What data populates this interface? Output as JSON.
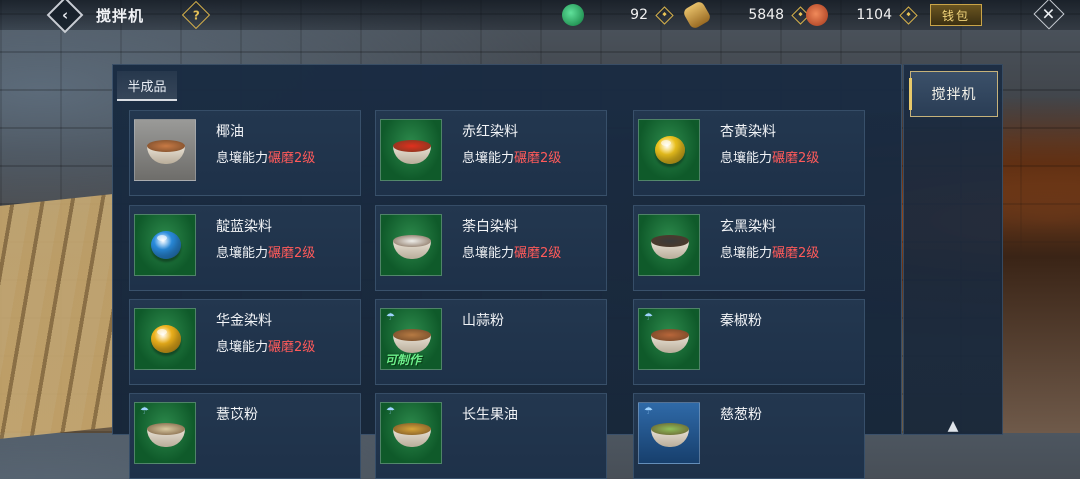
{
  "header": {
    "title": "搅拌机",
    "help_glyph": "?",
    "currencies": [
      {
        "name": "jade",
        "icon": "jade-coin-icon",
        "value": "92",
        "color": "#1fa45c"
      },
      {
        "name": "gold",
        "icon": "gold-ingot-icon",
        "value": "5848",
        "color": "#c99a3b"
      },
      {
        "name": "copper",
        "icon": "copper-coin-icon",
        "value": "1104",
        "color": "#d2633a"
      }
    ],
    "bag_label": "钱包",
    "close_glyph": "✕",
    "back_glyph": "‹"
  },
  "panel": {
    "tab_label": "半成品",
    "items": [
      {
        "name": "椰油",
        "req_prefix": "息壤能力",
        "req_level": "碾磨2级",
        "icon": "coconut-oil-icon",
        "bg": "grey",
        "fill": "#c87a45",
        "type": "bowl"
      },
      {
        "name": "赤红染料",
        "req_prefix": "息壤能力",
        "req_level": "碾磨2级",
        "icon": "red-dye-icon",
        "bg": "green",
        "fill": "#e0301e",
        "type": "bowl"
      },
      {
        "name": "杏黄染料",
        "req_prefix": "息壤能力",
        "req_level": "碾磨2级",
        "icon": "yellow-dye-icon",
        "bg": "green",
        "fill": "#f0c51e",
        "type": "orb"
      },
      {
        "name": "靛蓝染料",
        "req_prefix": "息壤能力",
        "req_level": "碾磨2级",
        "icon": "blue-dye-icon",
        "bg": "green",
        "fill": "#2a8ee0",
        "type": "orb"
      },
      {
        "name": "荼白染料",
        "req_prefix": "息壤能力",
        "req_level": "碾磨2级",
        "icon": "white-dye-icon",
        "bg": "green",
        "fill": "#eeeeea",
        "type": "bowl"
      },
      {
        "name": "玄黑染料",
        "req_prefix": "息壤能力",
        "req_level": "碾磨2级",
        "icon": "black-dye-icon",
        "bg": "green",
        "fill": "#3a3a3a",
        "type": "bowl"
      },
      {
        "name": "华金染料",
        "req_prefix": "息壤能力",
        "req_level": "碾磨2级",
        "icon": "gold-dye-icon",
        "bg": "green",
        "fill": "#f2b51c",
        "type": "orb"
      },
      {
        "name": "山蒜粉",
        "req_prefix": "",
        "req_level": "",
        "icon": "garlic-powder-icon",
        "bg": "green",
        "fill": "#b67a43",
        "type": "bowl",
        "craftable": "可制作"
      },
      {
        "name": "秦椒粉",
        "req_prefix": "",
        "req_level": "",
        "icon": "pepper-powder-icon",
        "bg": "green",
        "fill": "#b8663a",
        "type": "bowl"
      },
      {
        "name": "薏苡粉",
        "req_prefix": "",
        "req_level": "",
        "icon": "coix-powder-icon",
        "bg": "green",
        "fill": "#d9c9a0",
        "type": "bowl"
      },
      {
        "name": "长生果油",
        "req_prefix": "",
        "req_level": "",
        "icon": "peanut-oil-icon",
        "bg": "green",
        "fill": "#d6a43a",
        "type": "bowl"
      },
      {
        "name": "慈葱粉",
        "req_prefix": "",
        "req_level": "",
        "icon": "scallion-powder-icon",
        "bg": "blue",
        "fill": "#8fbf5a",
        "type": "bowl"
      }
    ]
  },
  "side": {
    "tab_label": "搅拌机"
  },
  "colors": {
    "panel_bg": "#1f344d",
    "accent_gold": "#d6b14a",
    "level_red": "#ff5a5a"
  }
}
